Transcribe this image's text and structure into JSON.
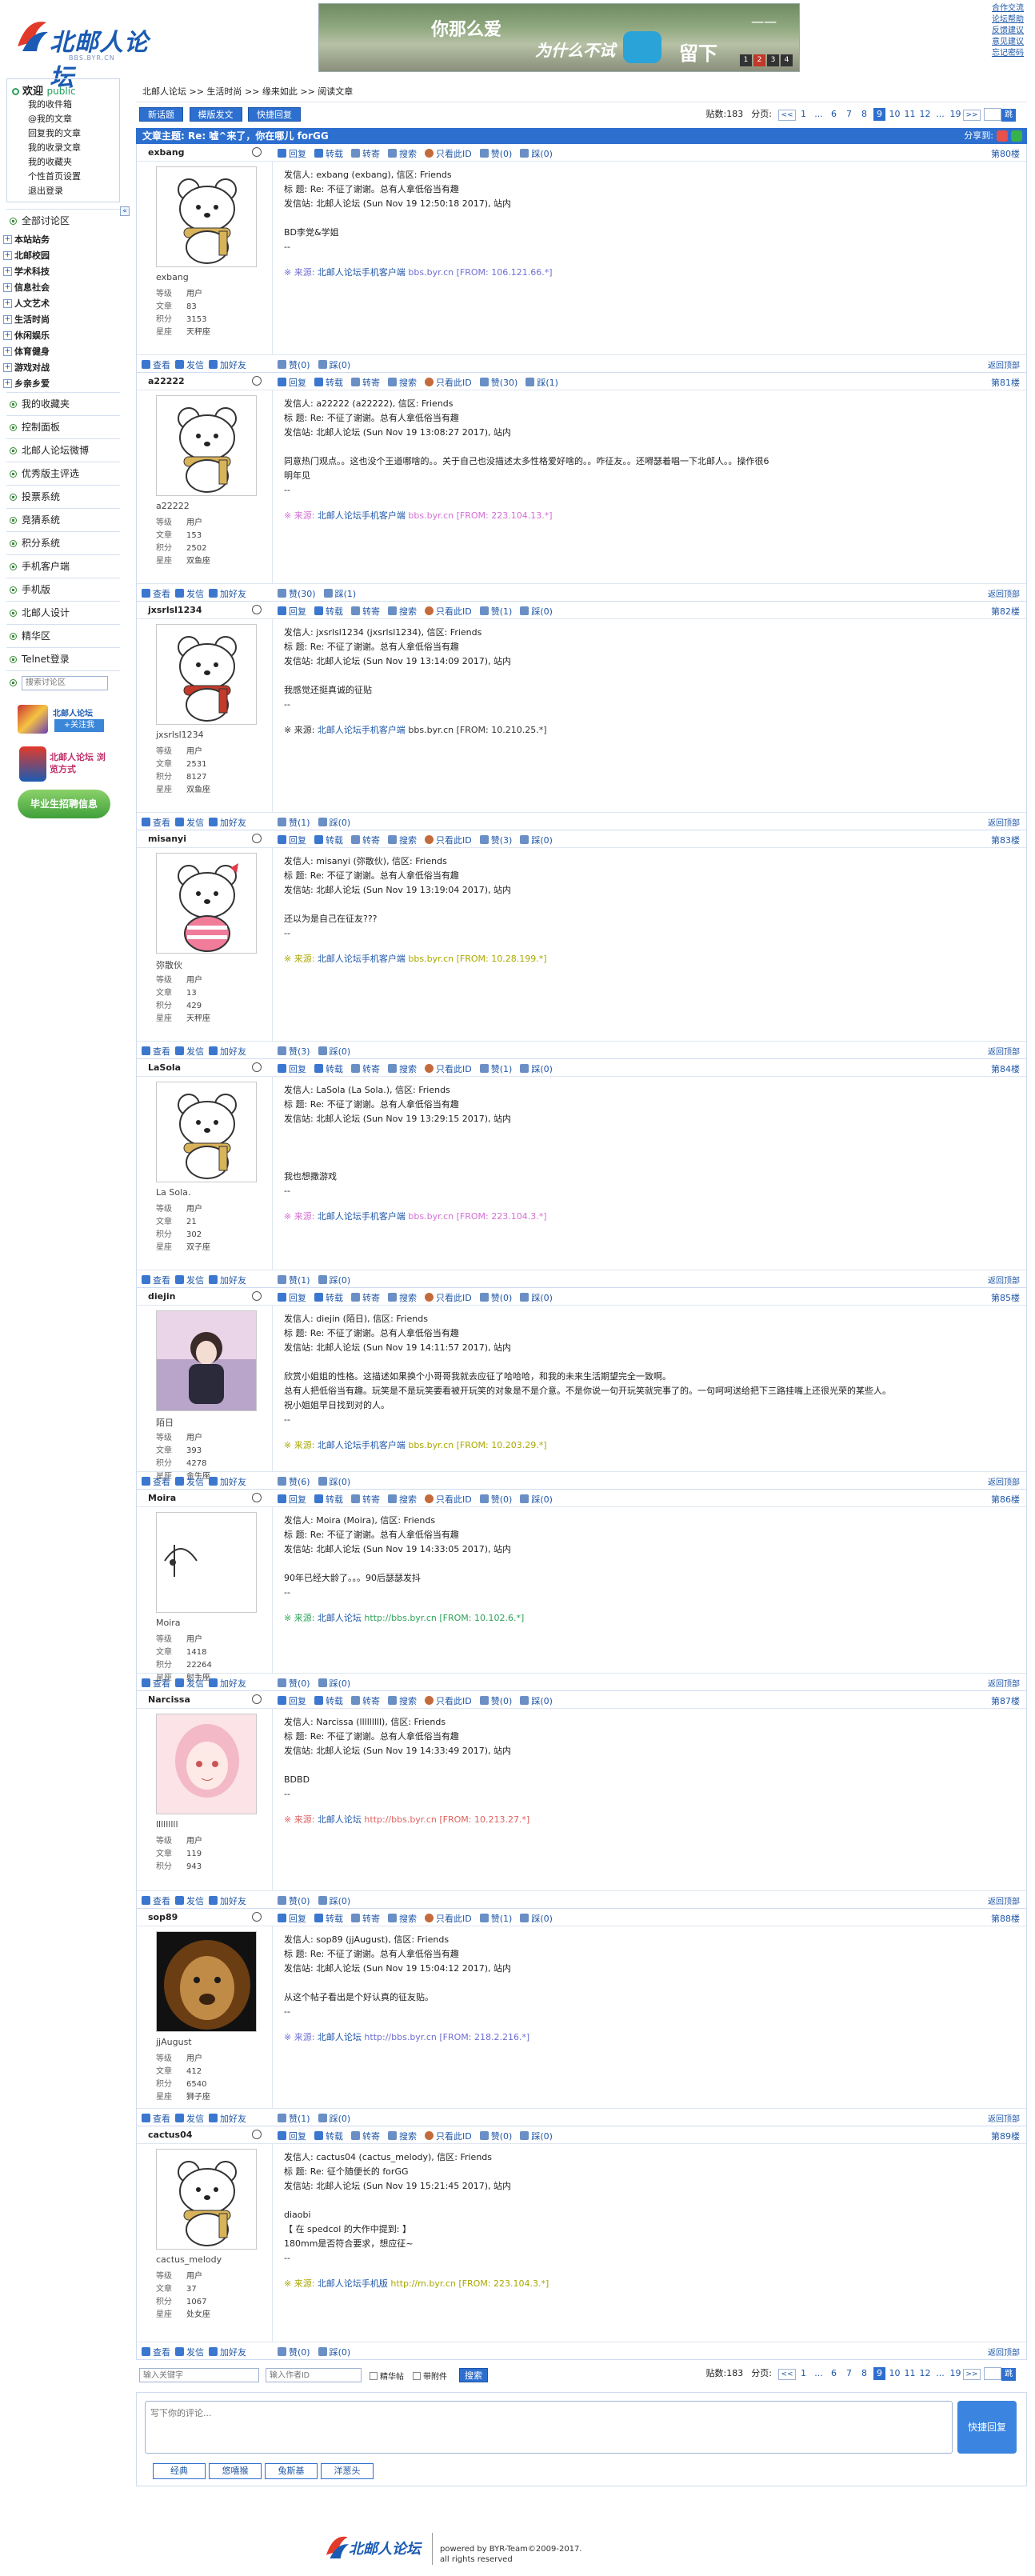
{
  "header": {
    "logo_text": "北邮人论坛",
    "logo_sub": "BBS.BYR.CN",
    "banner": {
      "line1": "你那么爱",
      "line2": "为什么不试",
      "line3": "留下",
      "fancy": "一一",
      "pages": [
        "1",
        "2",
        "3",
        "4"
      ]
    },
    "toplinks": [
      "合作交流",
      "论坛帮助",
      "反馈建议",
      "意见建议",
      "忘记密码"
    ]
  },
  "sidebar": {
    "welcome": "欢迎",
    "guest": "public",
    "user_links": [
      "我的收件箱",
      "@我的文章",
      "回复我的文章",
      "我的收录文章",
      "我的收藏夹",
      "个性首页设置",
      "退出登录"
    ],
    "all_boards": "全部讨论区",
    "boards": [
      "本站站务",
      "北邮校园",
      "学术科技",
      "信息社会",
      "人文艺术",
      "生活时尚",
      "休闲娱乐",
      "体育健身",
      "游戏对战",
      "乡亲乡爱"
    ],
    "sections": [
      "我的收藏夹",
      "控制面板",
      "北邮人论坛微博",
      "优秀版主评选",
      "投票系统",
      "竞猜系统",
      "积分系统",
      "手机客户端",
      "手机版",
      "北邮人设计",
      "精华区",
      "Telnet登录"
    ],
    "search_placeholder": "搜索讨论区",
    "ads": {
      "weibo": "北邮人论坛",
      "weibo_btn": "+关注我",
      "browse": "北邮人论坛 浏览方式",
      "job": "毕业生招聘信息"
    },
    "collapse": "«"
  },
  "main": {
    "breadcrumb": [
      "北邮人论坛",
      "生活时尚",
      "缘来如此",
      "阅读文章"
    ],
    "crumb_sep": ">>",
    "buttons": [
      "新话题",
      "模版发文",
      "快捷回复"
    ],
    "post_count_label": "贴数:",
    "post_count": "183",
    "page_label": "分页:",
    "pages": [
      "1",
      "...",
      "6",
      "7",
      "8",
      "9",
      "10",
      "11",
      "12",
      "...",
      "19"
    ],
    "current_page": "9",
    "prev": "<<",
    "next": ">>",
    "go": "跳",
    "title_label": "文章主题:",
    "title": "Re: 嘘^来了，你在哪儿 forGG",
    "share": "分享到:"
  },
  "labels": {
    "stat_level": "等级",
    "stat_posts": "文章",
    "stat_score": "积分",
    "stat_sign": "星座",
    "reply": "回复",
    "forward": "转载",
    "transfer": "转寄",
    "search": "搜索",
    "only_this": "只看此ID",
    "zan": "赞",
    "cai": "踩",
    "view": "查看",
    "mail": "发信",
    "addfriend": "加好友",
    "to_top": "返回顶部"
  },
  "posts": [
    {
      "id": "exbang",
      "floor": "第80楼",
      "display": "exbang",
      "level": "用户",
      "posts": "83",
      "score": "3153",
      "sign": "天秤座",
      "zan": "0",
      "cai": "0",
      "lines": [
        "发信人: exbang (exbang), 信区: Friends",
        "标  题: Re: 不征了谢谢。总有人拿低俗当有趣",
        "发信站: 北邮人论坛 (Sun Nov 19 12:50:18 2017), 站内",
        "",
        "BD李党&学姐",
        "--"
      ],
      "src_pre": "※ 来源: ",
      "src_link": "北邮人论坛手机客户端",
      "src_host": "bbs.byr.cn",
      "src_ip": "[FROM: 106.121.66.*]",
      "src_color": "#6f6fd4",
      "fzan": "0",
      "fcai": "0"
    },
    {
      "id": "a22222",
      "floor": "第81楼",
      "display": "a22222",
      "level": "用户",
      "posts": "153",
      "score": "2502",
      "sign": "双鱼座",
      "zan": "30",
      "cai": "1",
      "lines": [
        "发信人: a22222 (a22222), 信区: Friends",
        "标  题: Re: 不征了谢谢。总有人拿低俗当有趣",
        "发信站: 北邮人论坛 (Sun Nov 19 13:08:27 2017), 站内",
        "",
        "同意热门观点。。这也没个王道哪啥的。。关于自己也没描述太多性格爱好啥的。。咋征友。。还嘚瑟着唱一下北邮人。。操作很6",
        "明年见",
        "--"
      ],
      "src_pre": "※ 来源: ",
      "src_link": "北邮人论坛手机客户端",
      "src_host": "bbs.byr.cn",
      "src_ip": "[FROM: 223.104.13.*]",
      "src_color": "#d46fd4",
      "fzan": "30",
      "fcai": "1"
    },
    {
      "id": "jxsrlsl1234",
      "floor": "第82楼",
      "display": "jxsrlsl1234",
      "level": "用户",
      "posts": "2531",
      "score": "8127",
      "sign": "双鱼座",
      "zan": "1",
      "cai": "0",
      "lines": [
        "发信人: jxsrlsl1234 (jxsrlsl1234), 信区: Friends",
        "标  题: Re: 不征了谢谢。总有人拿低俗当有趣",
        "发信站: 北邮人论坛 (Sun Nov 19 13:14:09 2017), 站内",
        "",
        "我感觉还挺真诚的征贴",
        "--"
      ],
      "src_pre": "※ 来源: ",
      "src_link": "北邮人论坛手机客户端",
      "src_host": "bbs.byr.cn",
      "src_ip": "[FROM: 10.210.25.*]",
      "src_color": "#333333",
      "fzan": "1",
      "fcai": "0"
    },
    {
      "id": "misanyi",
      "floor": "第83楼",
      "display": "弥散伙",
      "level": "用户",
      "posts": "13",
      "score": "429",
      "sign": "天秤座",
      "zan": "3",
      "cai": "0",
      "lines": [
        "发信人: misanyi (弥散伙), 信区: Friends",
        "标  题: Re: 不征了谢谢。总有人拿低俗当有趣",
        "发信站: 北邮人论坛 (Sun Nov 19 13:19:04 2017), 站内",
        "",
        "还以为是自己在征友???",
        "--"
      ],
      "src_pre": "※ 来源: ",
      "src_link": "北邮人论坛手机客户端",
      "src_host": "bbs.byr.cn",
      "src_ip": "[FROM: 10.28.199.*]",
      "src_color": "#a8a800",
      "fzan": "3",
      "fcai": "0"
    },
    {
      "id": "LaSola",
      "floor": "第84楼",
      "display": "La Sola.",
      "level": "用户",
      "posts": "21",
      "score": "302",
      "sign": "双子座",
      "zan": "1",
      "cai": "0",
      "lines": [
        "发信人: LaSola (La Sola.), 信区: Friends",
        "标  题: Re: 不征了谢谢。总有人拿低俗当有趣",
        "发信站: 北邮人论坛 (Sun Nov 19 13:29:15 2017), 站内",
        "",
        "",
        "",
        "我也想撒游戏",
        "--"
      ],
      "src_pre": "※ 来源: ",
      "src_link": "北邮人论坛手机客户端",
      "src_host": "bbs.byr.cn",
      "src_ip": "[FROM: 223.104.3.*]",
      "src_color": "#d46fd4",
      "fzan": "1",
      "fcai": "0"
    },
    {
      "id": "diejin",
      "floor": "第85楼",
      "display": "陌日",
      "level": "用户",
      "posts": "393",
      "score": "4278",
      "sign": "金牛座",
      "zan": "0",
      "cai": "0",
      "lines": [
        "发信人: diejin (陌日), 信区: Friends",
        "标  题: Re: 不征了谢谢。总有人拿低俗当有趣",
        "发信站: 北邮人论坛 (Sun Nov 19 14:11:57 2017), 站内",
        "",
        "欣赏小姐姐的性格。这描述如果换个小哥哥我就去应征了哈哈哈，和我的未来生活期望完全一致啊。",
        "总有人把低俗当有趣。玩笑是不是玩笑要看被开玩笑的对象是不是介意。不是你说一句开玩笑就完事了的。一句呵呵送给把下三路挂嘴上还很光荣的某些人。",
        "祝小姐姐早日找到对的人。",
        "--"
      ],
      "src_pre": "※ 来源: ",
      "src_link": "北邮人论坛手机客户端",
      "src_host": "bbs.byr.cn",
      "src_ip": "[FROM: 10.203.29.*]",
      "src_color": "#a8a800",
      "fzan": "6",
      "fcai": "0"
    },
    {
      "id": "Moira",
      "floor": "第86楼",
      "display": "Moira",
      "level": "用户",
      "posts": "1418",
      "score": "22264",
      "sign": "射手座",
      "zan": "0",
      "cai": "0",
      "lines": [
        "发信人: Moira (Moira), 信区: Friends",
        "标  题: Re: 不征了谢谢。总有人拿低俗当有趣",
        "发信站: 北邮人论坛 (Sun Nov 19 14:33:05 2017), 站内",
        "",
        "90年已经大龄了。。。90后瑟瑟发抖",
        "--"
      ],
      "src_pre": "※ 来源: ",
      "src_link": "北邮人论坛",
      "src_host": "http://bbs.byr.cn",
      "src_ip": "[FROM: 10.102.6.*]",
      "src_color": "#2ea35a",
      "fzan": "0",
      "fcai": "0"
    },
    {
      "id": "Narcissa",
      "floor": "第87楼",
      "display": "lllllllll",
      "level": "用户",
      "posts": "119",
      "score": "943",
      "sign": "",
      "zan": "0",
      "cai": "0",
      "lines": [
        "发信人: Narcissa (lllllllll), 信区: Friends",
        "标  题: Re: 不征了谢谢。总有人拿低俗当有趣",
        "发信站: 北邮人论坛 (Sun Nov 19 14:33:49 2017), 站内",
        "",
        "BDBD",
        "--"
      ],
      "src_pre": "※ 来源: ",
      "src_link": "北邮人论坛",
      "src_host": "http://bbs.byr.cn",
      "src_ip": "[FROM: 10.213.27.*]",
      "src_color": "#e06060",
      "fzan": "0",
      "fcai": "0"
    },
    {
      "id": "sop89",
      "floor": "第88楼",
      "display": "jjAugust",
      "level": "用户",
      "posts": "412",
      "score": "6540",
      "sign": "狮子座",
      "zan": "1",
      "cai": "0",
      "lines": [
        "发信人: sop89 (jjAugust), 信区: Friends",
        "标  题: Re: 不征了谢谢。总有人拿低俗当有趣",
        "发信站: 北邮人论坛 (Sun Nov 19 15:04:12 2017), 站内",
        "",
        "从这个帖子看出是个好认真的征友贴。",
        "--"
      ],
      "src_pre": "※ 来源: ",
      "src_link": "北邮人论坛",
      "src_host": "http://bbs.byr.cn",
      "src_ip": "[FROM: 218.2.216.*]",
      "src_color": "#6f6fd4",
      "fzan": "1",
      "fcai": "0"
    },
    {
      "id": "cactus04",
      "floor": "第89楼",
      "display": "cactus_melody",
      "level": "用户",
      "posts": "37",
      "score": "1067",
      "sign": "处女座",
      "zan": "0",
      "cai": "0",
      "lines": [
        "发信人: cactus04 (cactus_melody), 信区: Friends",
        "标  题: Re: 征个随便长的 forGG",
        "发信站: 北邮人论坛 (Sun Nov 19 15:21:45 2017), 站内",
        "",
        "diaobi",
        "【 在 spedcol 的大作中提到: 】",
        "180mm是否符合要求，想应征~",
        "--"
      ],
      "src_pre": "※ 来源: ",
      "src_link": "北邮人论坛手机版",
      "src_host": "http://m.byr.cn",
      "src_ip": "[FROM: 223.104.3.*]",
      "src_color": "#a8a800",
      "fzan": "0",
      "fcai": "0"
    }
  ],
  "bottom": {
    "kw_placeholder": "输入关键字",
    "author_placeholder": "输入作者ID",
    "chk1": "精华帖",
    "chk2": "带附件",
    "search_btn": "搜索",
    "reply_placeholder": "写下你的评论...",
    "quick_reply": "快捷回复",
    "emo_tabs": [
      "经典",
      "悠嘻猴",
      "兔斯基",
      "洋葱头"
    ]
  },
  "footer": {
    "logo": "北邮人论坛",
    "line1": "powered by BYR-Team©2009-2017.",
    "line2": "all rights reserved"
  }
}
